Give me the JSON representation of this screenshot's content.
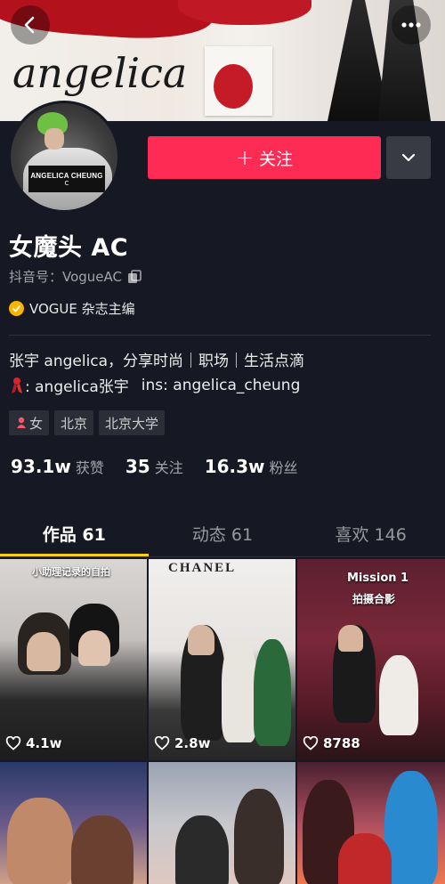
{
  "banner": {
    "script_text": "angelica"
  },
  "avatar": {
    "chair_text": "ANGELICA CHEUNG",
    "chair_mark": "C"
  },
  "actions": {
    "follow_label": "关注"
  },
  "profile": {
    "name": "女魔头 AC",
    "douyin_id": "抖音号：VogueAC",
    "verified_label": "VOGUE 杂志主编",
    "bio_line1": "张宇 angelica，分享时尚｜职场｜生活点滴",
    "bio_line2_a": ": angelica张宇",
    "bio_line2_b": "ins: angelica_cheung",
    "tags": [
      "女",
      "北京",
      "北京大学"
    ]
  },
  "stats": [
    {
      "value": "93.1w",
      "label": "获赞"
    },
    {
      "value": "35",
      "label": "关注"
    },
    {
      "value": "16.3w",
      "label": "粉丝"
    }
  ],
  "tabs": [
    {
      "label": "作品 61",
      "active": true
    },
    {
      "label": "动态 61",
      "active": false
    },
    {
      "label": "喜欢 146",
      "active": false
    }
  ],
  "videos": [
    {
      "likes": "4.1w",
      "caption": "小助理记录的自拍"
    },
    {
      "likes": "2.8w",
      "caption": "CHANEL"
    },
    {
      "likes": "8788",
      "caption": "Mission 1",
      "caption2": "拍摄合影"
    },
    {
      "likes": ""
    },
    {
      "likes": ""
    },
    {
      "likes": ""
    }
  ],
  "colors": {
    "background": "#161823",
    "follow": "#fe2c55",
    "tab_indicator": "#face15",
    "verified": "#f7b500"
  }
}
